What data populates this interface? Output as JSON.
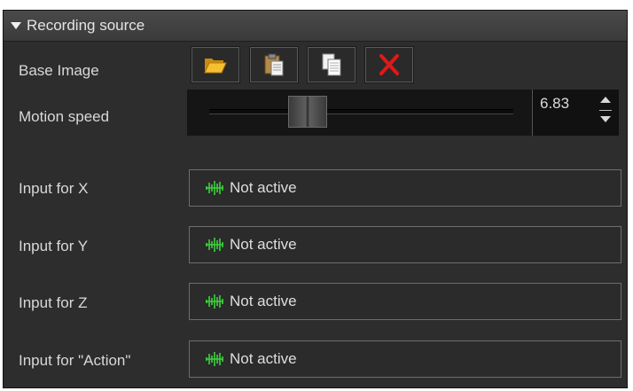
{
  "section": {
    "title": "Recording source"
  },
  "base_image": {
    "label": "Base Image",
    "buttons": [
      {
        "name": "open-folder-button",
        "icon": "folder-open-icon",
        "color": "#f0b428"
      },
      {
        "name": "paste-button",
        "icon": "clipboard-icon",
        "color": "#d8c49a"
      },
      {
        "name": "copy-button",
        "icon": "copy-icon",
        "color": "#ffffff"
      },
      {
        "name": "clear-button",
        "icon": "red-x-icon",
        "color": "#e02020"
      }
    ]
  },
  "motion_speed": {
    "label": "Motion speed",
    "value": "6.83",
    "slider_fraction": 0.3
  },
  "inputs": [
    {
      "label": "Input for X",
      "value": "Not active",
      "icon": "waveform-icon"
    },
    {
      "label": "Input for Y",
      "value": "Not active",
      "icon": "waveform-icon"
    },
    {
      "label": "Input for Z",
      "value": "Not active",
      "icon": "waveform-icon"
    },
    {
      "label": "Input for \"Action\"",
      "value": "Not active",
      "icon": "waveform-icon"
    }
  ],
  "colors": {
    "panel": "#2d2d2d",
    "waveform": "#3cd23c"
  }
}
